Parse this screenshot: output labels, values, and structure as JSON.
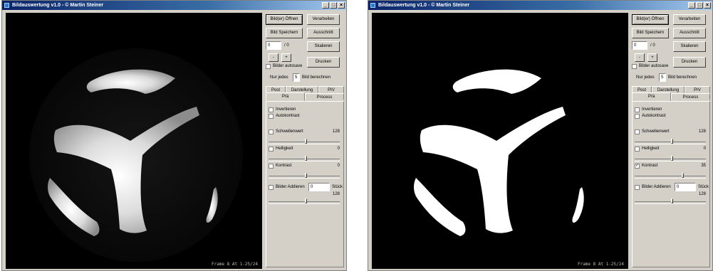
{
  "left": {
    "title": "Bildauswertung v1.0   -   © Martin Steiner",
    "stamp": "Frame 8 At 1-25/24",
    "buttons": {
      "open": "Bild(er) Öffnen",
      "process": "Verarbeiten",
      "save": "Bild Speichern",
      "cut": "Ausschnitt",
      "scale": "Skalieren",
      "print": "Drucken",
      "minus": "-",
      "plus": "+"
    },
    "frame_value": "0",
    "frame_total": "/ 0",
    "autosave_label": "Bilder autosave",
    "autosave_checked": false,
    "every_label": "Nur jedes",
    "every_value": "5",
    "every_suffix": "Bild berechnen",
    "tabs_row1": [
      "Post",
      "Darstellung",
      "PIV"
    ],
    "tabs_row2": [
      "Prä",
      "Process"
    ],
    "invert_label": "Invertieren",
    "invert_checked": false,
    "autocontrast_label": "Autokontrast",
    "autocontrast_checked": false,
    "threshold_label": "Schwellenwert",
    "threshold_checked": false,
    "threshold_value": "128",
    "brightness_label": "Helligkeit",
    "brightness_checked": false,
    "brightness_value": "0",
    "contrast_label": "Kontrast",
    "contrast_checked": false,
    "contrast_value": "0",
    "add_label": "Bilder Addieren",
    "add_checked": false,
    "add_value": "0",
    "add_unit": "Stück",
    "add_value2": "128"
  },
  "right": {
    "title": "Bildauswertung v1.0   -   © Martin Steiner",
    "stamp": "Frame 8 At 1-25/24",
    "buttons": {
      "open": "Bild(er) Öffnen",
      "process": "Verarbeiten",
      "save": "Bild Speichern",
      "cut": "Ausschnitt",
      "scale": "Skalieren",
      "print": "Drucken",
      "minus": "-",
      "plus": "+"
    },
    "frame_value": "0",
    "frame_total": "/ 0",
    "autosave_label": "Bilder autosave",
    "autosave_checked": false,
    "every_label": "Nur jedes",
    "every_value": "5",
    "every_suffix": "Bild berechnen",
    "tabs_row1": [
      "Post",
      "Darstellung",
      "PIV"
    ],
    "tabs_row2": [
      "Prä",
      "Process"
    ],
    "invert_label": "Invertieren",
    "invert_checked": false,
    "autocontrast_label": "Autokontrast",
    "autocontrast_checked": false,
    "threshold_label": "Schwellenwert",
    "threshold_checked": false,
    "threshold_value": "128",
    "brightness_label": "Helligkeit",
    "brightness_checked": false,
    "brightness_value": "0",
    "contrast_label": "Kontrast",
    "contrast_checked": true,
    "contrast_value": "35",
    "add_label": "Bilder Addieren",
    "add_checked": false,
    "add_value": "0",
    "add_unit": "Stück",
    "add_value2": "128"
  },
  "colors": {
    "title_start": "#0a246a",
    "title_end": "#a6caf0",
    "face": "#d4d0c8",
    "image_bg": "#000000"
  },
  "icons": {
    "app": "app-icon",
    "minimize": "minimize-icon",
    "maximize": "maximize-icon",
    "close": "close-icon"
  }
}
